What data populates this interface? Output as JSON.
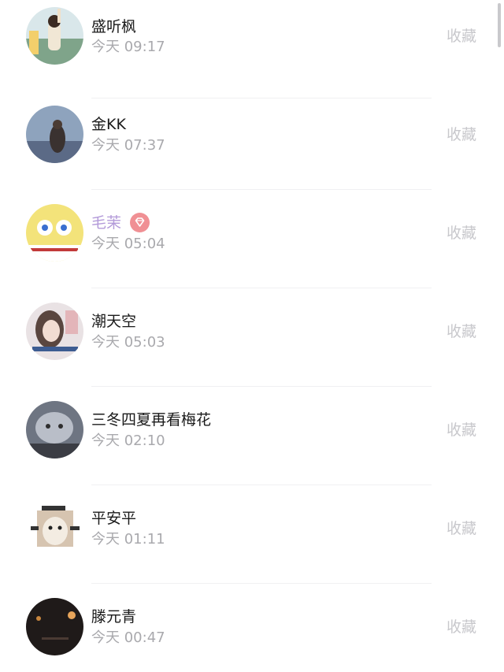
{
  "collect_label": "收藏",
  "vip_badge_color": "#f09094",
  "vip_name_color": "#b39ad9",
  "rows": [
    {
      "name": "盛听枫",
      "time": "今天 09:17"
    },
    {
      "name": "金KK",
      "time": "今天 07:37"
    },
    {
      "name": "毛茉",
      "time": "今天 05:04"
    },
    {
      "name": "潮天空",
      "time": "今天 05:03"
    },
    {
      "name": "三冬四夏再看梅花",
      "time": "今天 02:10"
    },
    {
      "name": "平安平",
      "time": "今天 01:11"
    },
    {
      "name": "滕元青",
      "time": "今天 00:47"
    }
  ]
}
